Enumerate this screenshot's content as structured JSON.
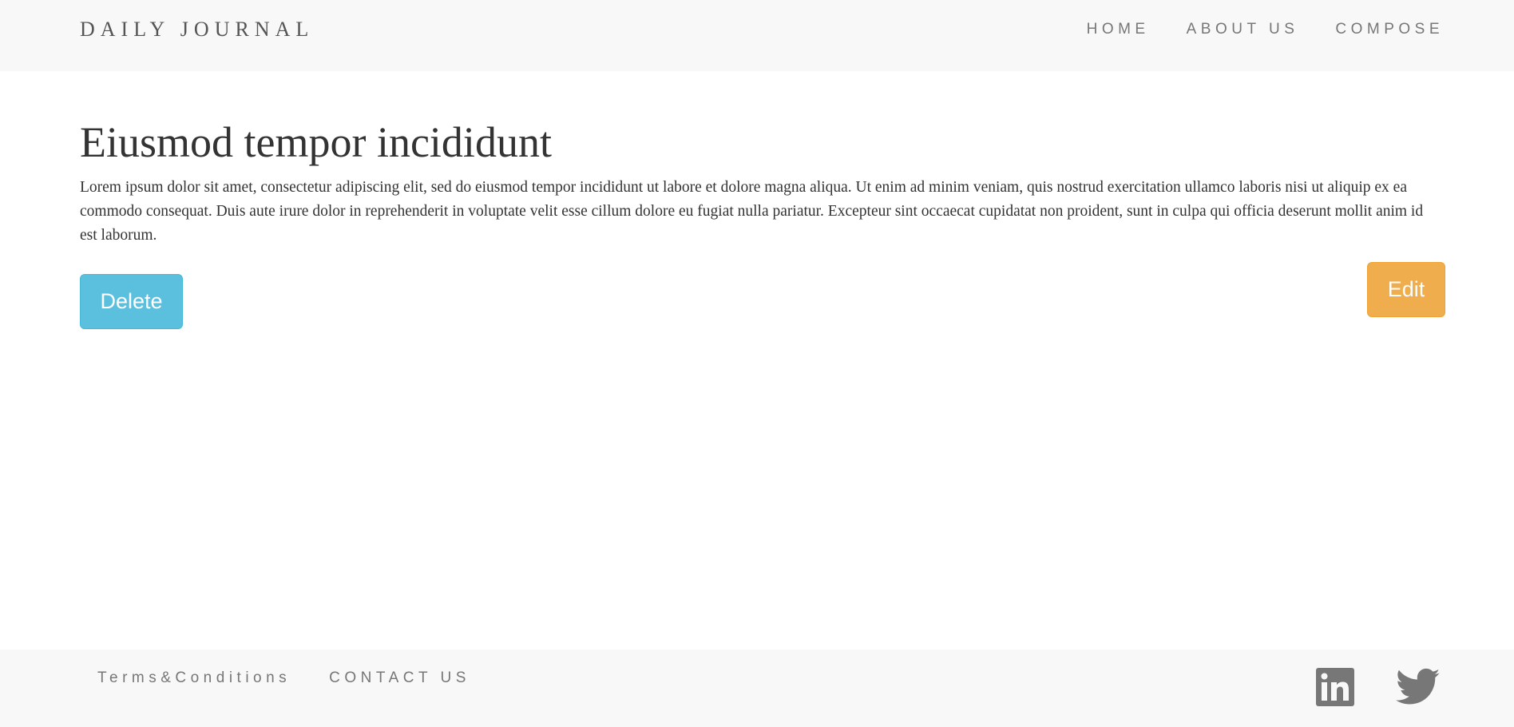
{
  "navbar": {
    "brand": "DAILY JOURNAL",
    "links": [
      "HOME",
      "ABOUT US",
      "COMPOSE"
    ]
  },
  "post": {
    "title": "Eiusmod tempor incididunt",
    "body": "Lorem ipsum dolor sit amet, consectetur adipiscing elit, sed do eiusmod tempor incididunt ut labore et dolore magna aliqua. Ut enim ad minim veniam, quis nostrud exercitation ullamco laboris nisi ut aliquip ex ea commodo consequat. Duis aute irure dolor in reprehenderit in voluptate velit esse cillum dolore eu fugiat nulla pariatur. Excepteur sint occaecat cupidatat non proident, sunt in culpa qui officia deserunt mollit anim id est laborum."
  },
  "actions": {
    "delete_label": "Delete",
    "edit_label": "Edit"
  },
  "footer": {
    "links": [
      "Terms&Conditions",
      "CONTACT US"
    ],
    "social_icons": [
      "linkedin-icon",
      "twitter-icon"
    ]
  },
  "colors": {
    "delete_button": "#5bc0de",
    "edit_button": "#f0ad4e",
    "bar_background": "#f8f8f8",
    "icon": "#777777"
  }
}
